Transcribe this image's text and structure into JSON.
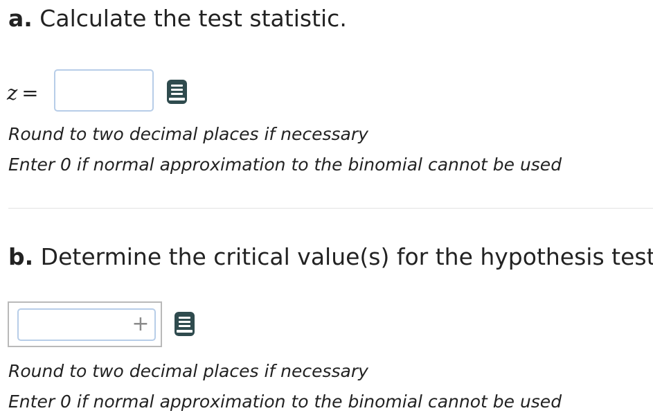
{
  "part_a": {
    "letter": "a.",
    "title": " Calculate the test statistic.",
    "variable": "z",
    "equals": "=",
    "input_value": "",
    "hint_round": "Round to two decimal places if necessary",
    "hint_zero": "Enter 0 if normal approximation to the binomial cannot be used",
    "icon": "book-icon"
  },
  "part_b": {
    "letter": "b.",
    "title": " Determine the critical value(s) for the hypothesis test.",
    "input_value": "",
    "add_symbol": "+",
    "hint_round": "Round to two decimal places if necessary",
    "hint_zero": "Enter 0 if normal approximation to the binomial cannot be used",
    "icon": "book-icon"
  },
  "colors": {
    "text": "#222222",
    "input_border": "#b7cde8",
    "icon": "#2f4b4e",
    "divider": "#e3e3e3"
  }
}
